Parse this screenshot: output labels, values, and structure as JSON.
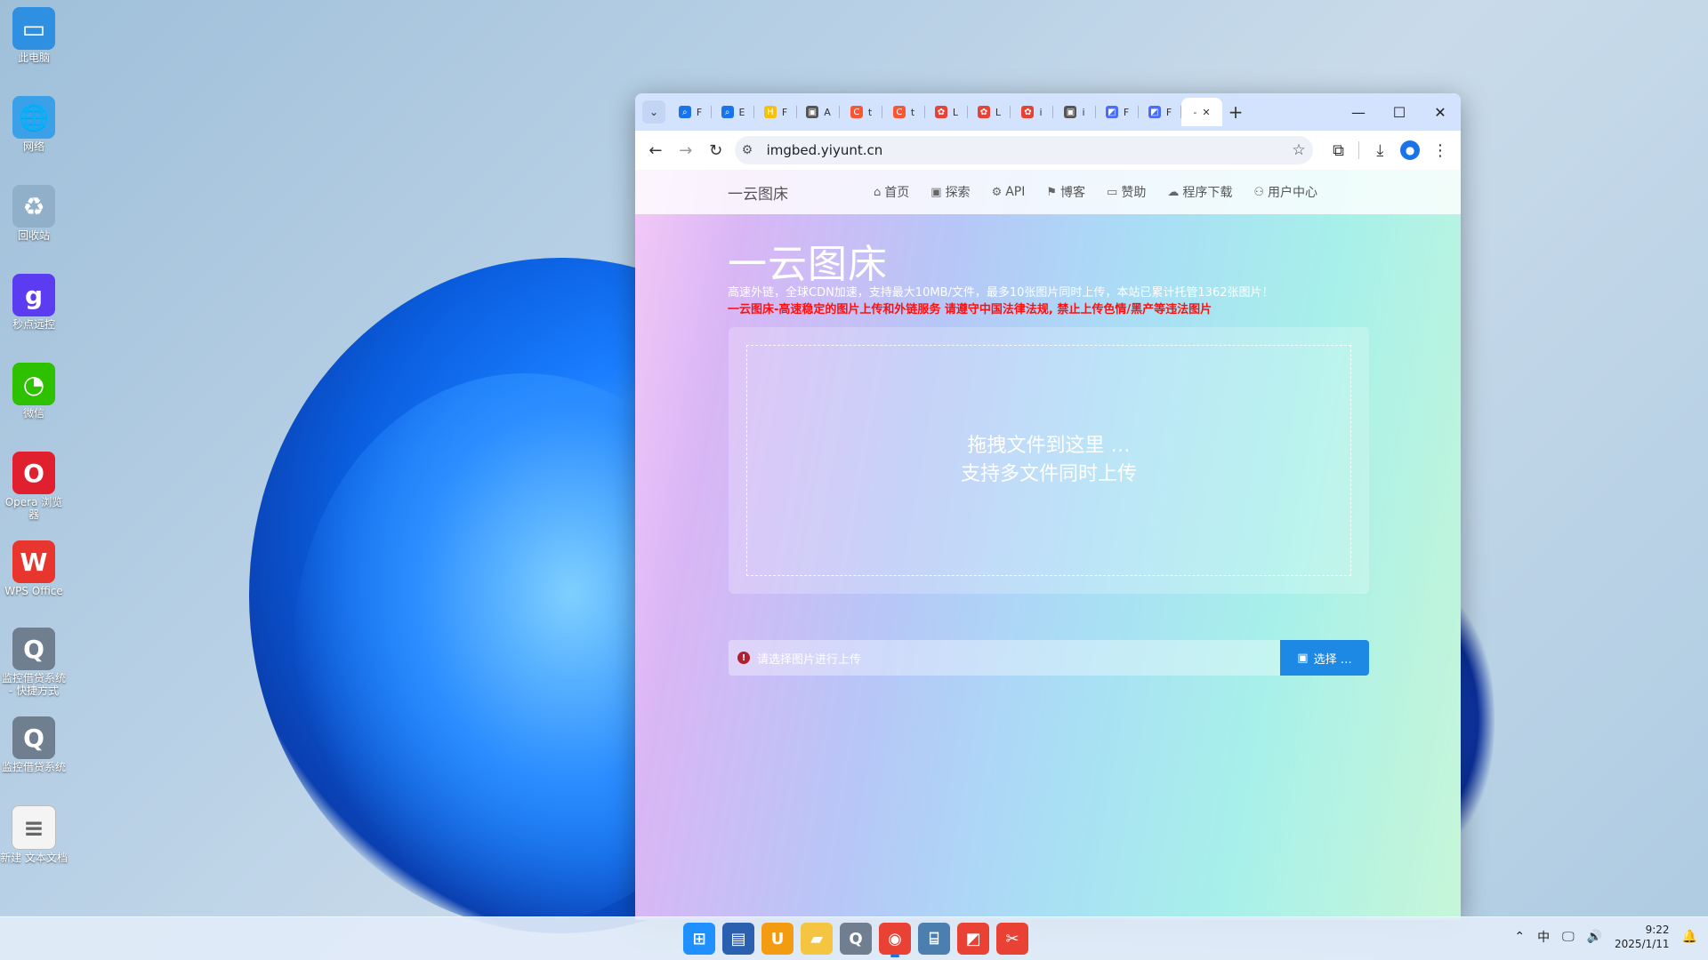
{
  "desktop": {
    "icons": [
      {
        "label": "此电脑",
        "icon": "monitor-icon",
        "color": "#2f8fe0"
      },
      {
        "label": "网络",
        "icon": "network-icon",
        "color": "#3aa0e8"
      },
      {
        "label": "回收站",
        "icon": "recycle-bin-icon",
        "color": "#8fb0c8"
      },
      {
        "label": "秒点远控",
        "icon": "remote-control-app-icon",
        "color": "#5b3cf0"
      },
      {
        "label": "微信",
        "icon": "wechat-icon",
        "color": "#2dc100"
      },
      {
        "label": "Opera 浏览器",
        "icon": "opera-icon",
        "color": "#e0202e"
      },
      {
        "label": "WPS Office",
        "icon": "wps-icon",
        "color": "#e8362f"
      },
      {
        "label": "监控借贷系统 - 快捷方式",
        "icon": "q-app-icon",
        "color": "#6f7f90"
      },
      {
        "label": "监控借贷系统",
        "icon": "q-app-icon",
        "color": "#6f7f90"
      },
      {
        "label": "新建 文本文档",
        "icon": "text-document-icon",
        "color": "#f4f4f4"
      }
    ]
  },
  "browser": {
    "tabs": [
      {
        "favicon": "search-icon",
        "text": "F",
        "color": "#1a73e8"
      },
      {
        "favicon": "search-icon",
        "text": "E",
        "color": "#1a73e8"
      },
      {
        "favicon": "h-icon",
        "text": "F",
        "color": "#f4c20d"
      },
      {
        "favicon": "image-icon",
        "text": "A",
        "color": "#555555"
      },
      {
        "favicon": "c-icon",
        "text": "t",
        "color": "#fc5531"
      },
      {
        "favicon": "c-icon",
        "text": "t",
        "color": "#fc5531"
      },
      {
        "favicon": "pinwheel-icon",
        "text": "L",
        "color": "#e94235"
      },
      {
        "favicon": "pinwheel-icon",
        "text": "L",
        "color": "#e94235"
      },
      {
        "favicon": "pinwheel-icon",
        "text": "i",
        "color": "#e94235"
      },
      {
        "favicon": "image-icon",
        "text": "i",
        "color": "#555555"
      },
      {
        "favicon": "image-tool-icon",
        "text": "F",
        "color": "#4a6cf7"
      },
      {
        "favicon": "image-tool-icon",
        "text": "F",
        "color": "#4a6cf7"
      }
    ],
    "active_tab": {
      "text": "-"
    },
    "url": "imgbed.yiyunt.cn"
  },
  "site": {
    "brand": "一云图床",
    "nav": [
      {
        "label": "首页",
        "icon": "home-icon",
        "glyph": "⌂"
      },
      {
        "label": "探索",
        "icon": "image-icon",
        "glyph": "▣"
      },
      {
        "label": "API",
        "icon": "gear-icon",
        "glyph": "⚙"
      },
      {
        "label": "博客",
        "icon": "signpost-icon",
        "glyph": "⚑"
      },
      {
        "label": "赞助",
        "icon": "wallet-icon",
        "glyph": "▭"
      },
      {
        "label": "程序下载",
        "icon": "cloud-download-icon",
        "glyph": "☁"
      },
      {
        "label": "用户中心",
        "icon": "user-icon",
        "glyph": "⚇"
      }
    ],
    "title": "一云图床",
    "subtitle": "高速外链，全球CDN加速，支持最大10MB/文件，最多10张图片同时上传，本站已累计托管1362张图片！",
    "notice": "一云图床-高速稳定的图片上传和外链服务 请遵守中国法律法规, 禁止上传色情/黑产等违法图片",
    "dropzone": {
      "line1": "拖拽文件到这里 …",
      "line2": "支持多文件同时上传"
    },
    "upload_message": "请选择图片进行上传",
    "choose_button": "选择 …"
  },
  "taskbar": {
    "apps": [
      {
        "icon": "windows-start-icon",
        "color": "#1e90ff"
      },
      {
        "icon": "store-icon",
        "color": "#2b5fb0"
      },
      {
        "icon": "horseshoe-app-icon",
        "color": "#f39c12"
      },
      {
        "icon": "file-explorer-icon",
        "color": "#f5c542"
      },
      {
        "icon": "q-app-icon",
        "color": "#6f7f90"
      },
      {
        "icon": "chrome-icon",
        "color": "#e94235"
      },
      {
        "icon": "network-tool-icon",
        "color": "#4a7fb0"
      },
      {
        "icon": "image-tool-icon",
        "color": "#e94235"
      },
      {
        "icon": "snipping-tool-icon",
        "color": "#e94235"
      }
    ],
    "tray": {
      "ime": "中",
      "time": "9:22",
      "date": "2025/1/11"
    }
  }
}
